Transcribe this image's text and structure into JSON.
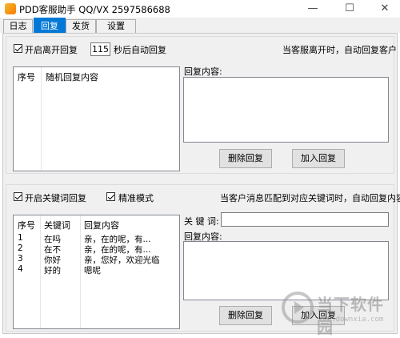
{
  "window": {
    "title": "PDD客服助手 QQ/VX 2597586688",
    "minimize": "—",
    "maximize": "☐",
    "close": "✕"
  },
  "tabs": [
    {
      "label": "日志",
      "active": false
    },
    {
      "label": "回复",
      "active": true
    },
    {
      "label": "发货",
      "active": false
    },
    {
      "label": "设置",
      "active": false
    }
  ],
  "away": {
    "checkbox_label": "开启离开回复",
    "checked": true,
    "seconds": "115",
    "seconds_suffix": "秒后自动回复",
    "hint": "当客服离开时，自动回复客户",
    "columns": [
      "序号",
      "随机回复内容"
    ],
    "content_label": "回复内容:",
    "delete_button": "删除回复",
    "add_button": "加入回复"
  },
  "keyword": {
    "checkbox_label": "开启关键词回复",
    "checked": true,
    "exact_label": "精准模式",
    "exact_checked": true,
    "hint": "当客户消息匹配到对应关键词时，自动回复内容",
    "columns": [
      "序号",
      "关键词",
      "回复内容"
    ],
    "rows": [
      {
        "no": "1",
        "kw": "在吗",
        "reply": "亲，在的呢，有..."
      },
      {
        "no": "2",
        "kw": "在不",
        "reply": "亲，在的呢，有..."
      },
      {
        "no": "3",
        "kw": "你好",
        "reply": "亲，您好，欢迎光临"
      },
      {
        "no": "4",
        "kw": "好的",
        "reply": "嗯呢"
      }
    ],
    "keyword_label": "关 键 词:",
    "content_label": "回复内容:",
    "delete_button": "删除回复",
    "add_button": "加入回复"
  },
  "watermark": {
    "text": "当下软件园",
    "url": "www.downxia.com"
  }
}
